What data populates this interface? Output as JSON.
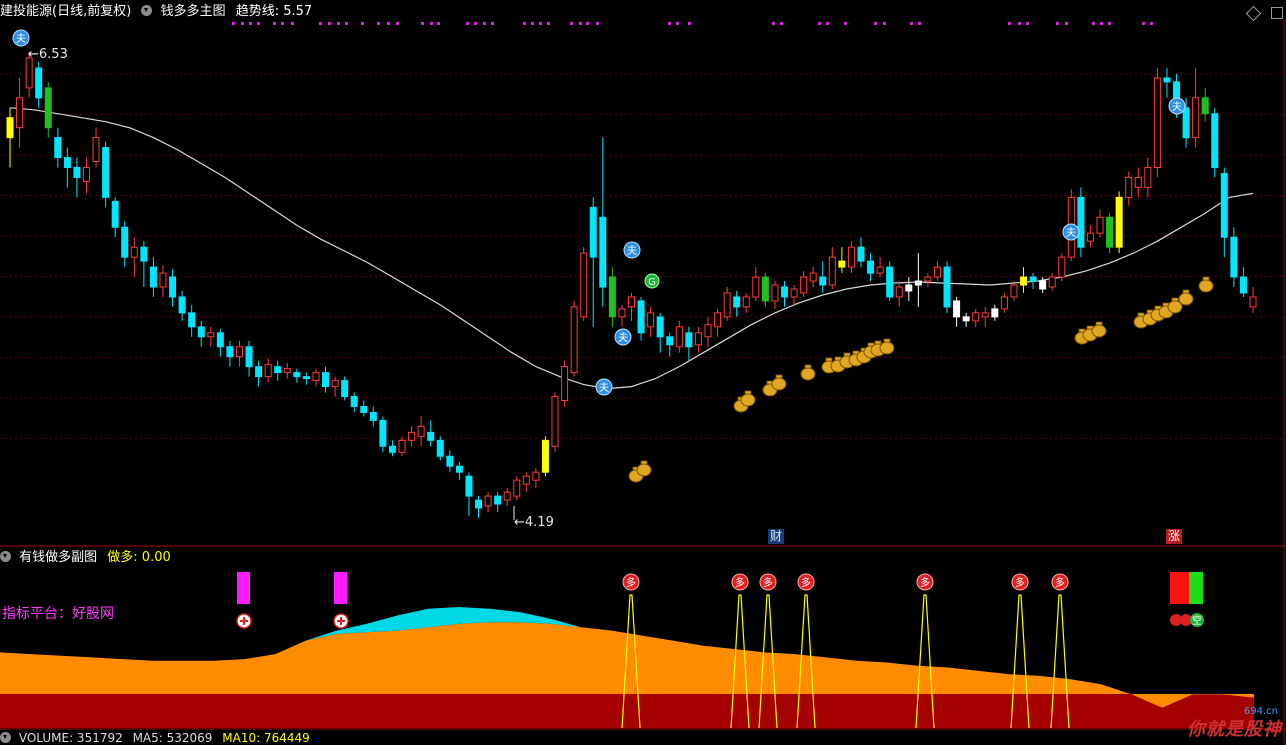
{
  "header": {
    "stock_name": "建投能源(日线,前复权)",
    "indicator_name": "钱多多主图",
    "trend_label": "趋势线: 5.57"
  },
  "sub_header": {
    "indicator_name": "有钱做多副图",
    "value_label": "做多: 0.00",
    "platform_label": "指标平台：好股网"
  },
  "volume_bar": {
    "volume": "VOLUME: 351792",
    "ma5": "MA5: 532069",
    "ma10": "MA10: 764449"
  },
  "annotations": {
    "high_price": "6.53",
    "low_price": "4.19",
    "cai_badge": "财",
    "zhang_badge": "涨",
    "buy_glyph": "夫",
    "g_glyph": "G",
    "duo_glyph": "多",
    "kong_glyph": "空"
  },
  "watermark": {
    "text": "你就是股神",
    "sub": "694.cn"
  },
  "colors": {
    "up": "#ff3b3b",
    "down": "#00e6ff",
    "yellow": "#ffff00",
    "green": "#21c021",
    "white": "#ffffff",
    "trend": "#d8d8d8",
    "orange": "#ff8c00",
    "darkred": "#a50000",
    "cyan_area": "#00d8e6",
    "magenta": "#ff1aff",
    "dot": "#e020e0"
  },
  "chart_data": {
    "type": "candlestick",
    "price_range": [
      4.1,
      6.75
    ],
    "candles": [
      [
        6.2,
        6.1,
        5.95,
        6.25,
        "yellow"
      ],
      [
        6.15,
        6.3,
        6.05,
        6.4,
        "up"
      ],
      [
        6.35,
        6.5,
        6.3,
        6.53,
        "up"
      ],
      [
        6.45,
        6.3,
        6.25,
        6.48,
        "down"
      ],
      [
        6.35,
        6.15,
        6.1,
        6.38,
        "green"
      ],
      [
        6.1,
        6.0,
        5.95,
        6.15,
        "down"
      ],
      [
        6.0,
        5.95,
        5.85,
        6.05,
        "down"
      ],
      [
        5.95,
        5.9,
        5.8,
        6.0,
        "down"
      ],
      [
        5.88,
        5.95,
        5.82,
        6.0,
        "up"
      ],
      [
        5.98,
        6.1,
        5.95,
        6.15,
        "up"
      ],
      [
        6.05,
        5.8,
        5.75,
        6.08,
        "down"
      ],
      [
        5.78,
        5.65,
        5.6,
        5.8,
        "down"
      ],
      [
        5.65,
        5.5,
        5.45,
        5.68,
        "down"
      ],
      [
        5.5,
        5.55,
        5.4,
        5.6,
        "up"
      ],
      [
        5.55,
        5.48,
        5.35,
        5.58,
        "down"
      ],
      [
        5.45,
        5.35,
        5.3,
        5.5,
        "down"
      ],
      [
        5.35,
        5.42,
        5.3,
        5.46,
        "up"
      ],
      [
        5.4,
        5.3,
        5.25,
        5.44,
        "down"
      ],
      [
        5.3,
        5.22,
        5.18,
        5.33,
        "down"
      ],
      [
        5.22,
        5.15,
        5.1,
        5.26,
        "down"
      ],
      [
        5.15,
        5.1,
        5.05,
        5.18,
        "down"
      ],
      [
        5.1,
        5.12,
        5.05,
        5.15,
        "up"
      ],
      [
        5.12,
        5.05,
        5.0,
        5.14,
        "down"
      ],
      [
        5.05,
        5.0,
        4.95,
        5.08,
        "down"
      ],
      [
        5.0,
        5.05,
        4.95,
        5.08,
        "up"
      ],
      [
        5.05,
        4.95,
        4.9,
        5.08,
        "down"
      ],
      [
        4.95,
        4.9,
        4.85,
        4.98,
        "down"
      ],
      [
        4.9,
        4.96,
        4.87,
        4.99,
        "up"
      ],
      [
        4.95,
        4.92,
        4.88,
        4.98,
        "down"
      ],
      [
        4.92,
        4.94,
        4.89,
        4.97,
        "up"
      ],
      [
        4.92,
        4.9,
        4.87,
        4.94,
        "down"
      ],
      [
        4.9,
        4.89,
        4.86,
        4.92,
        "down"
      ],
      [
        4.88,
        4.92,
        4.85,
        4.94,
        "up"
      ],
      [
        4.92,
        4.85,
        4.82,
        4.95,
        "down"
      ],
      [
        4.85,
        4.88,
        4.8,
        4.9,
        "up"
      ],
      [
        4.88,
        4.8,
        4.78,
        4.9,
        "down"
      ],
      [
        4.8,
        4.75,
        4.72,
        4.82,
        "down"
      ],
      [
        4.75,
        4.72,
        4.7,
        4.78,
        "down"
      ],
      [
        4.72,
        4.68,
        4.65,
        4.75,
        "down"
      ],
      [
        4.68,
        4.55,
        4.52,
        4.7,
        "down"
      ],
      [
        4.55,
        4.52,
        4.5,
        4.58,
        "down"
      ],
      [
        4.52,
        4.58,
        4.5,
        4.6,
        "up"
      ],
      [
        4.58,
        4.62,
        4.55,
        4.65,
        "up"
      ],
      [
        4.6,
        4.65,
        4.55,
        4.7,
        "up"
      ],
      [
        4.62,
        4.58,
        4.55,
        4.68,
        "down"
      ],
      [
        4.58,
        4.5,
        4.48,
        4.6,
        "down"
      ],
      [
        4.5,
        4.45,
        4.42,
        4.53,
        "down"
      ],
      [
        4.45,
        4.42,
        4.38,
        4.47,
        "down"
      ],
      [
        4.4,
        4.3,
        4.2,
        4.42,
        "down"
      ],
      [
        4.28,
        4.24,
        4.19,
        4.3,
        "down"
      ],
      [
        4.25,
        4.3,
        4.22,
        4.32,
        "up"
      ],
      [
        4.3,
        4.26,
        4.22,
        4.32,
        "down"
      ],
      [
        4.28,
        4.32,
        4.25,
        4.34,
        "up"
      ],
      [
        4.3,
        4.38,
        4.28,
        4.4,
        "up"
      ],
      [
        4.36,
        4.4,
        4.32,
        4.42,
        "up"
      ],
      [
        4.38,
        4.42,
        4.34,
        4.44,
        "up"
      ],
      [
        4.42,
        4.58,
        4.4,
        4.6,
        "yellow"
      ],
      [
        4.55,
        4.8,
        4.52,
        4.82,
        "up"
      ],
      [
        4.78,
        4.95,
        4.75,
        4.98,
        "up"
      ],
      [
        4.92,
        5.25,
        4.9,
        5.28,
        "up"
      ],
      [
        5.2,
        5.52,
        5.18,
        5.55,
        "up"
      ],
      [
        5.5,
        5.75,
        5.15,
        5.8,
        "down"
      ],
      [
        5.7,
        5.35,
        5.25,
        6.1,
        "down"
      ],
      [
        5.4,
        5.2,
        5.15,
        5.45,
        "green"
      ],
      [
        5.2,
        5.24,
        5.15,
        5.26,
        "up"
      ],
      [
        5.25,
        5.3,
        5.18,
        5.32,
        "up"
      ],
      [
        5.28,
        5.12,
        5.08,
        5.3,
        "down"
      ],
      [
        5.15,
        5.22,
        5.1,
        5.25,
        "up"
      ],
      [
        5.2,
        5.1,
        5.02,
        5.22,
        "down"
      ],
      [
        5.1,
        5.06,
        5.0,
        5.12,
        "down"
      ],
      [
        5.05,
        5.15,
        5.02,
        5.18,
        "up"
      ],
      [
        5.12,
        5.05,
        4.98,
        5.15,
        "down"
      ],
      [
        5.06,
        5.12,
        5.02,
        5.15,
        "up"
      ],
      [
        5.1,
        5.16,
        5.05,
        5.2,
        "up"
      ],
      [
        5.15,
        5.22,
        5.1,
        5.24,
        "up"
      ],
      [
        5.2,
        5.32,
        5.18,
        5.35,
        "up"
      ],
      [
        5.3,
        5.25,
        5.2,
        5.33,
        "down"
      ],
      [
        5.25,
        5.3,
        5.22,
        5.32,
        "up"
      ],
      [
        5.3,
        5.4,
        5.28,
        5.45,
        "up"
      ],
      [
        5.4,
        5.28,
        5.25,
        5.42,
        "green"
      ],
      [
        5.28,
        5.36,
        5.24,
        5.38,
        "up"
      ],
      [
        5.35,
        5.3,
        5.25,
        5.38,
        "down"
      ],
      [
        5.3,
        5.34,
        5.26,
        5.36,
        "up"
      ],
      [
        5.32,
        5.4,
        5.3,
        5.43,
        "up"
      ],
      [
        5.38,
        5.42,
        5.35,
        5.45,
        "up"
      ],
      [
        5.4,
        5.36,
        5.32,
        5.48,
        "down"
      ],
      [
        5.36,
        5.5,
        5.34,
        5.55,
        "up"
      ],
      [
        5.48,
        5.45,
        5.42,
        5.55,
        "yellow"
      ],
      [
        5.45,
        5.55,
        5.42,
        5.58,
        "up"
      ],
      [
        5.55,
        5.48,
        5.45,
        5.6,
        "down"
      ],
      [
        5.48,
        5.42,
        5.38,
        5.52,
        "down"
      ],
      [
        5.42,
        5.45,
        5.4,
        5.5,
        "up"
      ],
      [
        5.45,
        5.3,
        5.28,
        5.48,
        "down"
      ],
      [
        5.3,
        5.35,
        5.25,
        5.38,
        "up"
      ],
      [
        5.33,
        5.36,
        5.28,
        5.4,
        "white"
      ],
      [
        5.36,
        5.38,
        5.25,
        5.52,
        "white"
      ],
      [
        5.38,
        5.4,
        5.35,
        5.42,
        "up"
      ],
      [
        5.4,
        5.45,
        5.38,
        5.48,
        "up"
      ],
      [
        5.45,
        5.25,
        5.22,
        5.48,
        "down"
      ],
      [
        5.28,
        5.2,
        5.15,
        5.3,
        "white"
      ],
      [
        5.2,
        5.18,
        5.15,
        5.22,
        "white"
      ],
      [
        5.18,
        5.22,
        5.15,
        5.24,
        "up"
      ],
      [
        5.22,
        5.2,
        5.15,
        5.25,
        "up"
      ],
      [
        5.2,
        5.24,
        5.18,
        5.26,
        "white"
      ],
      [
        5.24,
        5.3,
        5.22,
        5.32,
        "up"
      ],
      [
        5.3,
        5.36,
        5.28,
        5.38,
        "up"
      ],
      [
        5.36,
        5.4,
        5.32,
        5.45,
        "yellow"
      ],
      [
        5.4,
        5.38,
        5.34,
        5.42,
        "down"
      ],
      [
        5.38,
        5.34,
        5.32,
        5.4,
        "white"
      ],
      [
        5.35,
        5.4,
        5.33,
        5.42,
        "up"
      ],
      [
        5.4,
        5.5,
        5.38,
        5.52,
        "up"
      ],
      [
        5.5,
        5.8,
        5.48,
        5.84,
        "up"
      ],
      [
        5.8,
        5.55,
        5.5,
        5.85,
        "down"
      ],
      [
        5.58,
        5.62,
        5.55,
        5.66,
        "up"
      ],
      [
        5.62,
        5.7,
        5.6,
        5.74,
        "up"
      ],
      [
        5.7,
        5.55,
        5.52,
        5.72,
        "green"
      ],
      [
        5.55,
        5.8,
        5.52,
        5.83,
        "yellow"
      ],
      [
        5.8,
        5.9,
        5.76,
        5.93,
        "up"
      ],
      [
        5.9,
        5.85,
        5.8,
        5.95,
        "up"
      ],
      [
        5.85,
        5.95,
        5.8,
        6.0,
        "up"
      ],
      [
        5.95,
        6.4,
        5.9,
        6.45,
        "up"
      ],
      [
        6.4,
        6.38,
        6.3,
        6.45,
        "down"
      ],
      [
        6.38,
        6.25,
        6.2,
        6.42,
        "down"
      ],
      [
        6.25,
        6.1,
        6.05,
        6.3,
        "down"
      ],
      [
        6.1,
        6.3,
        6.05,
        6.45,
        "up"
      ],
      [
        6.3,
        6.22,
        6.18,
        6.35,
        "green"
      ],
      [
        6.22,
        5.95,
        5.9,
        6.25,
        "down"
      ],
      [
        5.92,
        5.6,
        5.5,
        5.95,
        "down"
      ],
      [
        5.6,
        5.4,
        5.35,
        5.65,
        "down"
      ],
      [
        5.4,
        5.32,
        5.3,
        5.45,
        "down"
      ],
      [
        5.3,
        5.25,
        5.22,
        5.35,
        "up"
      ]
    ],
    "trend": [
      6.25,
      6.24,
      6.22,
      6.2,
      6.18,
      6.15,
      6.1,
      6.04,
      5.97,
      5.9,
      5.82,
      5.74,
      5.66,
      5.59,
      5.53,
      5.47,
      5.4,
      5.33,
      5.26,
      5.18,
      5.1,
      5.02,
      4.95,
      4.9,
      4.86,
      4.84,
      4.85,
      4.89,
      4.95,
      5.02,
      5.09,
      5.16,
      5.22,
      5.27,
      5.31,
      5.34,
      5.36,
      5.37,
      5.375,
      5.37,
      5.365,
      5.36,
      5.37,
      5.38,
      5.4,
      5.43,
      5.47,
      5.52,
      5.58,
      5.65,
      5.72,
      5.8,
      5.82
    ],
    "sub_area": [
      0.45,
      0.44,
      0.43,
      0.42,
      0.41,
      0.4,
      0.4,
      0.4,
      0.41,
      0.44,
      0.52,
      0.56,
      0.57,
      0.58,
      0.6,
      0.62,
      0.63,
      0.63,
      0.62,
      0.6,
      0.58,
      0.55,
      0.52,
      0.49,
      0.47,
      0.45,
      0.44,
      0.42,
      0.4,
      0.39,
      0.37,
      0.36,
      0.34,
      0.32,
      0.31,
      0.29,
      0.26,
      0.2,
      0.12,
      0.2,
      0.2,
      0.18
    ],
    "sub_cyan": [
      0,
      0,
      0,
      0,
      0,
      0,
      0,
      0,
      0,
      0,
      0,
      0.02,
      0.05,
      0.09,
      0.11,
      0.1,
      0.08,
      0.06,
      0.03,
      0,
      0,
      0,
      0,
      0,
      0,
      0,
      0,
      0,
      0,
      0,
      0,
      0,
      0,
      0,
      0,
      0,
      0,
      0,
      0,
      0,
      0,
      0
    ],
    "spikes": [
      631,
      740,
      768,
      806,
      925,
      1020,
      1060
    ]
  }
}
